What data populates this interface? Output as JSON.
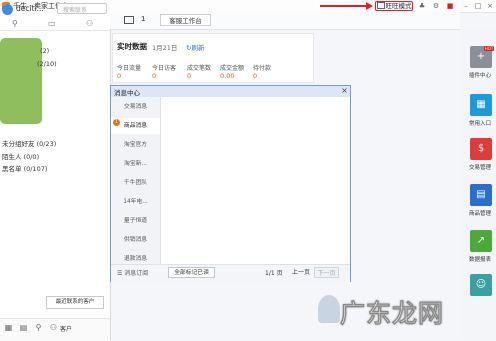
{
  "titlebar": {
    "app_title": "千牛 - 卖家工作台",
    "mode_button": "旺旺模式"
  },
  "left": {
    "username": "deciti...",
    "search_placeholder": "搜索联系",
    "counts": [
      "(2)",
      "(2/10)"
    ],
    "groups": [
      "未分组好友 (0/23)",
      "陌生人 (0/0)",
      "黑名单 (0/107)"
    ],
    "tooltip": "最近联系的客户",
    "bottom_label": "客户"
  },
  "toolbar": {
    "mail_count": "1",
    "service_button": "客服工作台"
  },
  "realtime": {
    "title": "实时数据",
    "date": "1月21日",
    "refresh": "刷新",
    "stats": [
      {
        "label": "今日流量",
        "value": "0"
      },
      {
        "label": "今日访客",
        "value": "0"
      },
      {
        "label": "成交笔数",
        "value": "0"
      },
      {
        "label": "成交金额",
        "value": "0.00"
      },
      {
        "label": "待付款",
        "value": "0"
      }
    ]
  },
  "message_center": {
    "title": "消息中心",
    "close": "×",
    "categories": [
      "交易消息",
      "商品消息",
      "淘宝官方",
      "淘宝新...",
      "千牛团队",
      "14年电...",
      "量子恒道",
      "供销消息",
      "退款消息"
    ],
    "active_badge": "1",
    "subscribe": "消息订阅",
    "mark_all_read": "全部标记已读",
    "page_info": "1/1 页",
    "prev": "上一页",
    "next": "下一页"
  },
  "rightbar": {
    "hot_badge": "HOT",
    "items": [
      {
        "label": "插件中心",
        "icon": "plus-icon",
        "color": "#8a8f98",
        "glyph": "+"
      },
      {
        "label": "常用入口",
        "icon": "grid-icon",
        "color": "#1f9ad8",
        "glyph": "▦"
      },
      {
        "label": "交易管理",
        "icon": "money-icon",
        "color": "#e03b3b",
        "glyph": "$"
      },
      {
        "label": "商品管理",
        "icon": "goods-icon",
        "color": "#2a6fcf",
        "glyph": "▤"
      },
      {
        "label": "数据报表",
        "icon": "chart-icon",
        "color": "#4caa3c",
        "glyph": "↗"
      },
      {
        "label": "",
        "icon": "user-icon",
        "color": "#3aa0a0",
        "glyph": "☺"
      }
    ]
  },
  "watermark": "广东龙网"
}
